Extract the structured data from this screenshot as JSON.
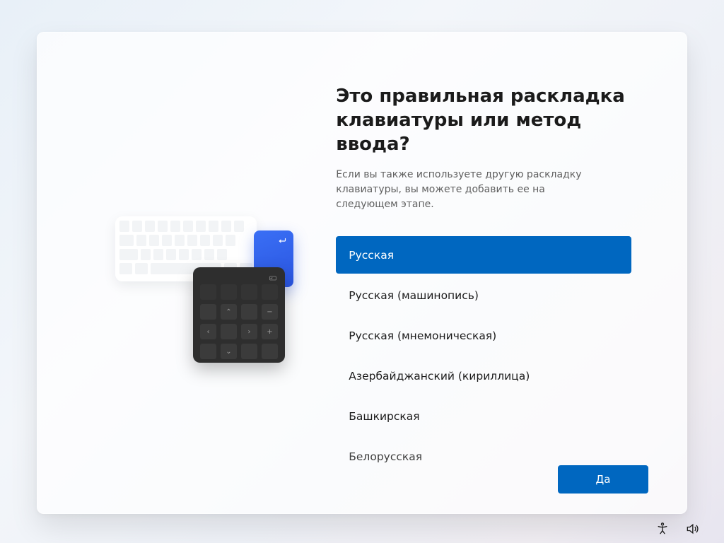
{
  "title": "Это правильная раскладка клавиатуры или метод ввода?",
  "subtitle": "Если вы также используете другую раскладку клавиатуры, вы можете добавить ее на следующем этапе.",
  "layouts": [
    {
      "label": "Русская",
      "selected": true
    },
    {
      "label": "Русская (машинопись)",
      "selected": false
    },
    {
      "label": "Русская (мнемоническая)",
      "selected": false
    },
    {
      "label": "Азербайджанский (кириллица)",
      "selected": false
    },
    {
      "label": "Башкирская",
      "selected": false
    },
    {
      "label": "Белорусская",
      "selected": false
    }
  ],
  "yes_button": "Да",
  "icons": {
    "accessibility": "accessibility-icon",
    "volume": "volume-icon"
  }
}
